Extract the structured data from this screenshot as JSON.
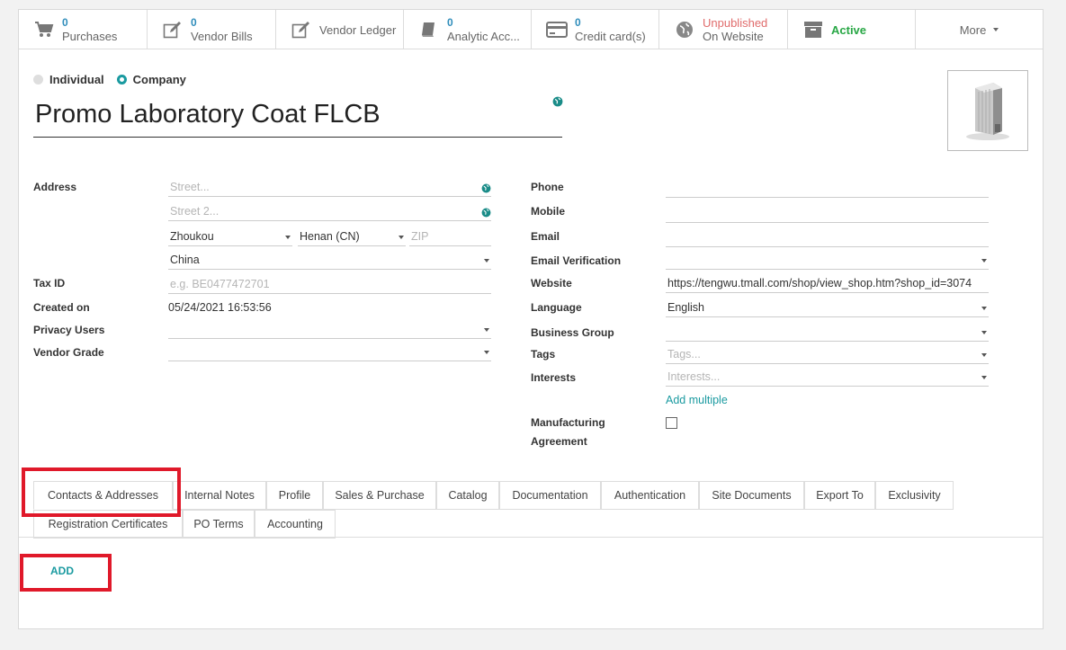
{
  "smart_buttons": [
    {
      "icon": "cart-icon",
      "num": "0",
      "label": "Purchases"
    },
    {
      "icon": "edit-icon",
      "num": "0",
      "label": "Vendor Bills"
    },
    {
      "icon": "edit-icon",
      "label": "Vendor Ledger"
    },
    {
      "icon": "book-icon",
      "num": "0",
      "label": "Analytic Acc..."
    },
    {
      "icon": "credit-card-icon",
      "num": "0",
      "label": "Credit card(s)"
    },
    {
      "icon": "globe-icon",
      "status": "Unpublished",
      "label": "On Website"
    },
    {
      "icon": "archive-icon",
      "label": "Active"
    },
    {
      "label": "More"
    }
  ],
  "company_type": {
    "individual": "Individual",
    "company": "Company",
    "selected": "Company"
  },
  "partner_name": "Promo Laboratory Coat FLCB",
  "left_fields": {
    "address_label": "Address",
    "street_placeholder": "Street...",
    "street2_placeholder": "Street 2...",
    "city": "Zhoukou",
    "state": "Henan (CN)",
    "zip_placeholder": "ZIP",
    "country": "China",
    "tax_id_label": "Tax ID",
    "tax_id_placeholder": "e.g. BE0477472701",
    "created_on_label": "Created on",
    "created_on": "05/24/2021 16:53:56",
    "privacy_users_label": "Privacy Users",
    "vendor_grade_label": "Vendor Grade"
  },
  "right_fields": {
    "phone_label": "Phone",
    "mobile_label": "Mobile",
    "email_label": "Email",
    "email_verification_label": "Email Verification",
    "website_label": "Website",
    "website": "https://tengwu.tmall.com/shop/view_shop.htm?shop_id=3074",
    "language_label": "Language",
    "language": "English",
    "business_group_label": "Business Group",
    "tags_label": "Tags",
    "tags_placeholder": "Tags...",
    "interests_label": "Interests",
    "interests_placeholder": "Interests...",
    "add_multiple": "Add multiple",
    "manufacturing_label_1": "Manufacturing",
    "manufacturing_label_2": "Agreement"
  },
  "tabs": [
    "Contacts & Addresses",
    "Internal Notes",
    "Profile",
    "Sales & Purchase",
    "Catalog",
    "Documentation",
    "Authentication",
    "Site Documents",
    "Export To",
    "Exclusivity",
    "Registration Certificates",
    "PO Terms",
    "Accounting"
  ],
  "active_tab": "Contacts & Addresses",
  "add_button": "ADD",
  "colors": {
    "accent": "#1a9aa0",
    "highlight": "#e0192a",
    "unpublished": "#e06c6c",
    "active": "#28a745",
    "count": "#2f8dbb"
  }
}
